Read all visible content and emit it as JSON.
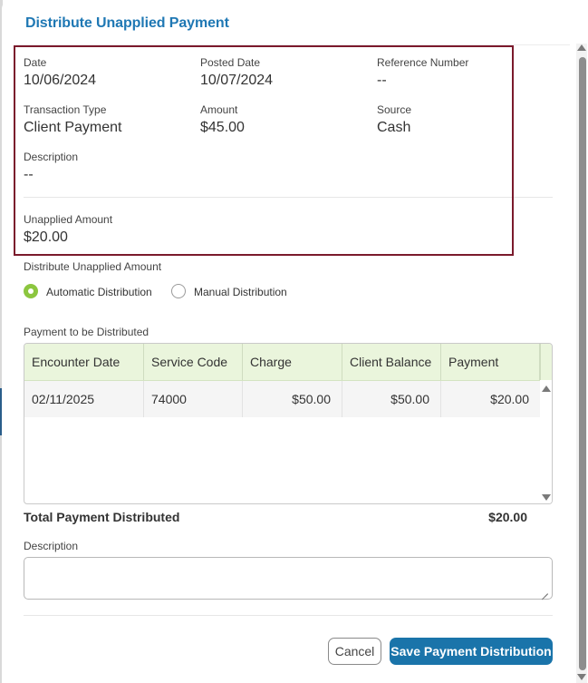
{
  "modal": {
    "title": "Distribute Unapplied Payment"
  },
  "details": {
    "date_label": "Date",
    "date_value": "10/06/2024",
    "posted_label": "Posted Date",
    "posted_value": "10/07/2024",
    "reference_label": "Reference Number",
    "reference_value": "--",
    "type_label": "Transaction Type",
    "type_value": "Client Payment",
    "amount_label": "Amount",
    "amount_value": "$45.00",
    "source_label": "Source",
    "source_value": "Cash",
    "description_label": "Description",
    "description_value": "--",
    "unapplied_label": "Unapplied Amount",
    "unapplied_value": "$20.00"
  },
  "distribution": {
    "label": "Distribute Unapplied Amount",
    "options": [
      {
        "label": "Automatic Distribution",
        "selected": true
      },
      {
        "label": "Manual Distribution",
        "selected": false
      }
    ]
  },
  "payment_grid": {
    "label": "Payment to be Distributed",
    "columns": [
      "Encounter Date",
      "Service Code",
      "Charge",
      "Client Balance",
      "Payment"
    ],
    "rows": [
      [
        "02/11/2025",
        "74000",
        "$50.00",
        "$50.00",
        "$20.00"
      ]
    ]
  },
  "total": {
    "label": "Total Payment Distributed",
    "value": "$20.00"
  },
  "description": {
    "label": "Description",
    "value": "",
    "placeholder": ""
  },
  "buttons": {
    "cancel": "Cancel",
    "save": "Save Payment Distribution"
  },
  "colors": {
    "accent": "#1a74aa",
    "title": "#1f78b4",
    "highlight_border": "#7b1a2c",
    "radio_on": "#8cc63f",
    "grid_header": "#eaf5dc"
  }
}
